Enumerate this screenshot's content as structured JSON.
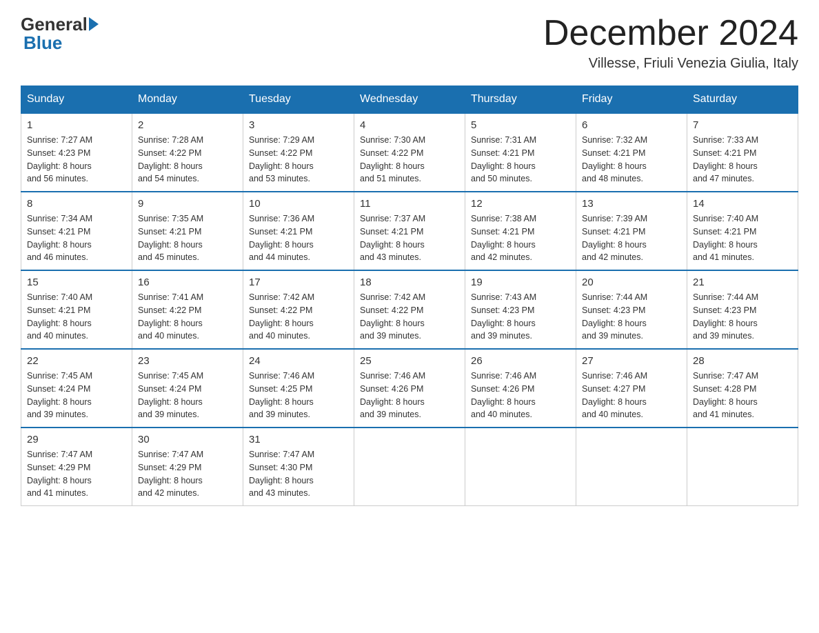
{
  "logo": {
    "general": "General",
    "blue": "Blue"
  },
  "title": "December 2024",
  "subtitle": "Villesse, Friuli Venezia Giulia, Italy",
  "headers": [
    "Sunday",
    "Monday",
    "Tuesday",
    "Wednesday",
    "Thursday",
    "Friday",
    "Saturday"
  ],
  "weeks": [
    [
      {
        "day": "1",
        "info": "Sunrise: 7:27 AM\nSunset: 4:23 PM\nDaylight: 8 hours\nand 56 minutes."
      },
      {
        "day": "2",
        "info": "Sunrise: 7:28 AM\nSunset: 4:22 PM\nDaylight: 8 hours\nand 54 minutes."
      },
      {
        "day": "3",
        "info": "Sunrise: 7:29 AM\nSunset: 4:22 PM\nDaylight: 8 hours\nand 53 minutes."
      },
      {
        "day": "4",
        "info": "Sunrise: 7:30 AM\nSunset: 4:22 PM\nDaylight: 8 hours\nand 51 minutes."
      },
      {
        "day": "5",
        "info": "Sunrise: 7:31 AM\nSunset: 4:21 PM\nDaylight: 8 hours\nand 50 minutes."
      },
      {
        "day": "6",
        "info": "Sunrise: 7:32 AM\nSunset: 4:21 PM\nDaylight: 8 hours\nand 48 minutes."
      },
      {
        "day": "7",
        "info": "Sunrise: 7:33 AM\nSunset: 4:21 PM\nDaylight: 8 hours\nand 47 minutes."
      }
    ],
    [
      {
        "day": "8",
        "info": "Sunrise: 7:34 AM\nSunset: 4:21 PM\nDaylight: 8 hours\nand 46 minutes."
      },
      {
        "day": "9",
        "info": "Sunrise: 7:35 AM\nSunset: 4:21 PM\nDaylight: 8 hours\nand 45 minutes."
      },
      {
        "day": "10",
        "info": "Sunrise: 7:36 AM\nSunset: 4:21 PM\nDaylight: 8 hours\nand 44 minutes."
      },
      {
        "day": "11",
        "info": "Sunrise: 7:37 AM\nSunset: 4:21 PM\nDaylight: 8 hours\nand 43 minutes."
      },
      {
        "day": "12",
        "info": "Sunrise: 7:38 AM\nSunset: 4:21 PM\nDaylight: 8 hours\nand 42 minutes."
      },
      {
        "day": "13",
        "info": "Sunrise: 7:39 AM\nSunset: 4:21 PM\nDaylight: 8 hours\nand 42 minutes."
      },
      {
        "day": "14",
        "info": "Sunrise: 7:40 AM\nSunset: 4:21 PM\nDaylight: 8 hours\nand 41 minutes."
      }
    ],
    [
      {
        "day": "15",
        "info": "Sunrise: 7:40 AM\nSunset: 4:21 PM\nDaylight: 8 hours\nand 40 minutes."
      },
      {
        "day": "16",
        "info": "Sunrise: 7:41 AM\nSunset: 4:22 PM\nDaylight: 8 hours\nand 40 minutes."
      },
      {
        "day": "17",
        "info": "Sunrise: 7:42 AM\nSunset: 4:22 PM\nDaylight: 8 hours\nand 40 minutes."
      },
      {
        "day": "18",
        "info": "Sunrise: 7:42 AM\nSunset: 4:22 PM\nDaylight: 8 hours\nand 39 minutes."
      },
      {
        "day": "19",
        "info": "Sunrise: 7:43 AM\nSunset: 4:23 PM\nDaylight: 8 hours\nand 39 minutes."
      },
      {
        "day": "20",
        "info": "Sunrise: 7:44 AM\nSunset: 4:23 PM\nDaylight: 8 hours\nand 39 minutes."
      },
      {
        "day": "21",
        "info": "Sunrise: 7:44 AM\nSunset: 4:23 PM\nDaylight: 8 hours\nand 39 minutes."
      }
    ],
    [
      {
        "day": "22",
        "info": "Sunrise: 7:45 AM\nSunset: 4:24 PM\nDaylight: 8 hours\nand 39 minutes."
      },
      {
        "day": "23",
        "info": "Sunrise: 7:45 AM\nSunset: 4:24 PM\nDaylight: 8 hours\nand 39 minutes."
      },
      {
        "day": "24",
        "info": "Sunrise: 7:46 AM\nSunset: 4:25 PM\nDaylight: 8 hours\nand 39 minutes."
      },
      {
        "day": "25",
        "info": "Sunrise: 7:46 AM\nSunset: 4:26 PM\nDaylight: 8 hours\nand 39 minutes."
      },
      {
        "day": "26",
        "info": "Sunrise: 7:46 AM\nSunset: 4:26 PM\nDaylight: 8 hours\nand 40 minutes."
      },
      {
        "day": "27",
        "info": "Sunrise: 7:46 AM\nSunset: 4:27 PM\nDaylight: 8 hours\nand 40 minutes."
      },
      {
        "day": "28",
        "info": "Sunrise: 7:47 AM\nSunset: 4:28 PM\nDaylight: 8 hours\nand 41 minutes."
      }
    ],
    [
      {
        "day": "29",
        "info": "Sunrise: 7:47 AM\nSunset: 4:29 PM\nDaylight: 8 hours\nand 41 minutes."
      },
      {
        "day": "30",
        "info": "Sunrise: 7:47 AM\nSunset: 4:29 PM\nDaylight: 8 hours\nand 42 minutes."
      },
      {
        "day": "31",
        "info": "Sunrise: 7:47 AM\nSunset: 4:30 PM\nDaylight: 8 hours\nand 43 minutes."
      },
      null,
      null,
      null,
      null
    ]
  ]
}
